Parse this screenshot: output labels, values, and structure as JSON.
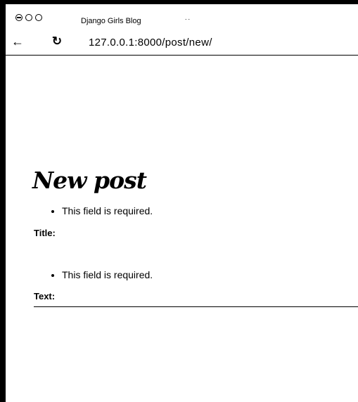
{
  "browser": {
    "tab_title": "Django Girls Blog",
    "tab_extra": "..",
    "address": "127.0.0.1:8000/post/new/",
    "back_icon": "arrow-left-icon",
    "reload_icon": "reload-icon",
    "back_glyph": "←",
    "reload_glyph": "↻"
  },
  "page": {
    "heading": "New post",
    "errors": {
      "title": "This field is required.",
      "text": "This field is required."
    },
    "fields": {
      "title_label": "Title:",
      "text_label": "Text:"
    }
  }
}
